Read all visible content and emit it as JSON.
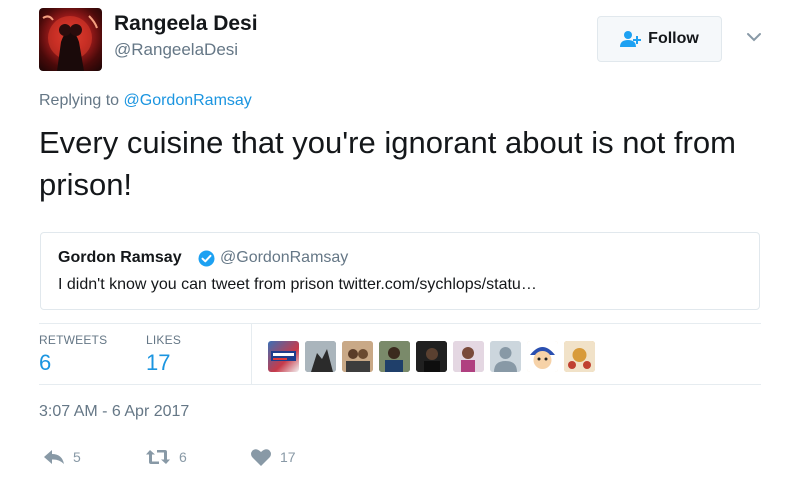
{
  "author": {
    "display_name": "Rangeela Desi",
    "handle": "@RangeelaDesi"
  },
  "follow_button": {
    "label": "Follow",
    "icon": "add-user-icon"
  },
  "caret_icon": "chevron-down-icon",
  "reply": {
    "prefix": "Replying to ",
    "mention": "@GordonRamsay"
  },
  "tweet": {
    "text": "Every cuisine that you're ignorant about is not from prison!"
  },
  "quoted_tweet": {
    "display_name": "Gordon Ramsay",
    "verified_icon": "verified-badge-icon",
    "handle": "@GordonRamsay",
    "text": "I didn't know you can tweet from prison twitter.com/sychlops/statu…"
  },
  "stats": {
    "retweets_label": "RETWEETS",
    "retweets_value": "6",
    "likes_label": "LIKES",
    "likes_value": "17"
  },
  "likers": [
    "liker-avatar-1",
    "liker-avatar-2",
    "liker-avatar-3",
    "liker-avatar-4",
    "liker-avatar-5",
    "liker-avatar-6",
    "liker-avatar-7",
    "liker-avatar-8",
    "liker-avatar-9",
    "liker-avatar-10"
  ],
  "timestamp": "3:07 AM - 6 Apr 2017",
  "actions": {
    "reply_icon": "reply-icon",
    "reply_count": "5",
    "retweet_icon": "retweet-icon",
    "retweet_count": "6",
    "like_icon": "heart-icon",
    "like_count": "17"
  },
  "colors": {
    "link": "#1b95e0",
    "muted": "#657786",
    "text": "#14171a",
    "border": "#e1e8ed",
    "verified": "#1da1f2"
  }
}
